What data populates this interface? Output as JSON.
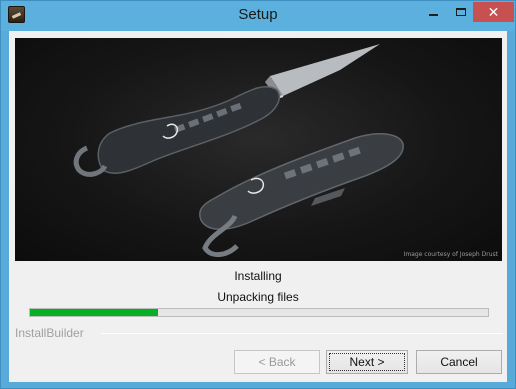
{
  "window": {
    "title": "Setup",
    "icon": "installer-app-icon",
    "controls": {
      "minimize": "minimize-icon",
      "maximize": "maximize-icon",
      "close": "close-icon",
      "close_glyph": "✕"
    }
  },
  "banner": {
    "credit": "Image courtesy of Joseph Drust"
  },
  "status": {
    "line1": "Installing",
    "line2": "Unpacking files",
    "progress_fraction": 0.28
  },
  "brand": {
    "text": "InstallBuilder"
  },
  "buttons": {
    "back": "< Back",
    "next": "Next >",
    "cancel": "Cancel"
  },
  "colors": {
    "titlebar": "#5cb0de",
    "close_button": "#c75050",
    "progress": "#06b025"
  }
}
